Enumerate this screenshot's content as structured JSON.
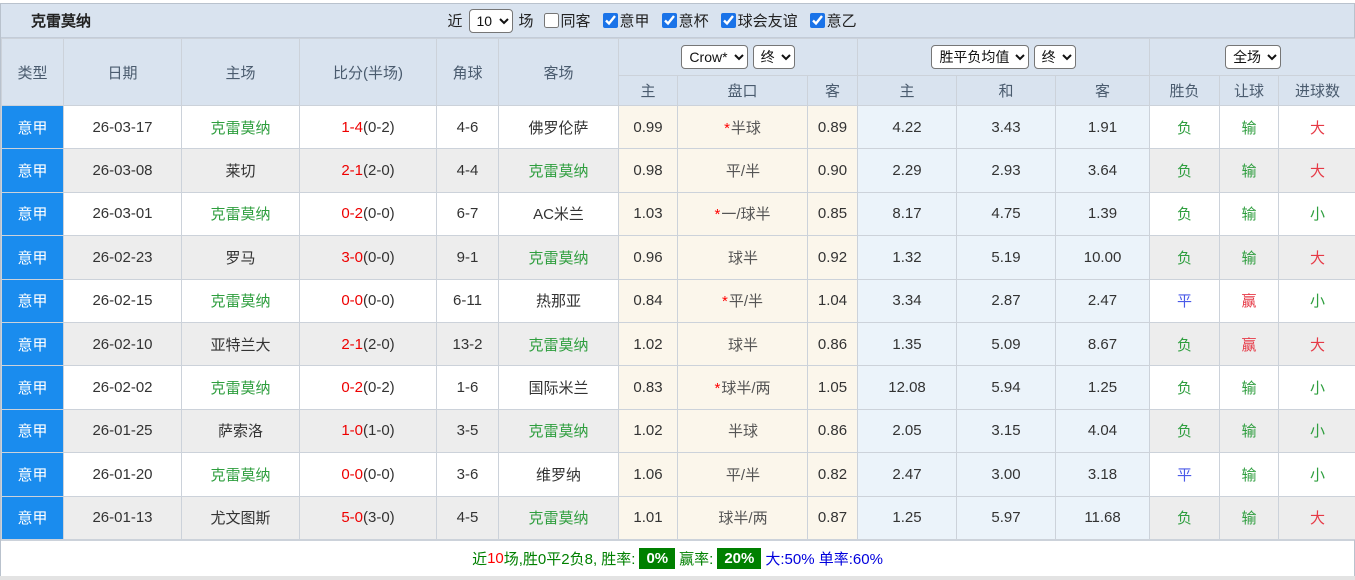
{
  "toolbar": {
    "team": "克雷莫纳",
    "recent_label": "近",
    "recent_value": "10",
    "recent_suffix": "场",
    "filters": [
      {
        "label": "同客",
        "checked": false
      },
      {
        "label": "意甲",
        "checked": true
      },
      {
        "label": "意杯",
        "checked": true
      },
      {
        "label": "球会友谊",
        "checked": true
      },
      {
        "label": "意乙",
        "checked": true
      }
    ]
  },
  "header": {
    "type": "类型",
    "date": "日期",
    "home": "主场",
    "score": "比分(半场)",
    "corner": "角球",
    "away": "客场",
    "odds_company_select": "Crow*",
    "odds_state_select": "终",
    "avg_select": "胜平负均值",
    "avg_state_select": "终",
    "fulltime_select": "全场",
    "odds_home": "主",
    "odds_pan": "盘口",
    "odds_away": "客",
    "avg_win": "主",
    "avg_draw": "和",
    "avg_lose": "客",
    "res_wdl": "胜负",
    "res_handicap": "让球",
    "res_goals": "进球数"
  },
  "rows": [
    {
      "league": "意甲",
      "date": "26-03-17",
      "home": "克雷莫纳",
      "home_c": "green",
      "score": "1-4",
      "half": "(0-2)",
      "corners": "4-6",
      "away": "佛罗伦萨",
      "away_c": "dark",
      "o_home": "0.99",
      "pan_star": "*",
      "pan": "半球",
      "o_away": "0.89",
      "m_win": "4.22",
      "m_draw": "3.43",
      "m_lose": "1.91",
      "r_wdl": "负",
      "r_wdl_c": "green",
      "r_pan": "输",
      "r_pan_c": "green",
      "r_goal": "大",
      "r_goal_c": "red"
    },
    {
      "league": "意甲",
      "date": "26-03-08",
      "home": "莱切",
      "home_c": "dark",
      "score": "2-1",
      "half": "(2-0)",
      "corners": "4-4",
      "away": "克雷莫纳",
      "away_c": "green",
      "o_home": "0.98",
      "pan_star": "",
      "pan": "平/半",
      "o_away": "0.90",
      "m_win": "2.29",
      "m_draw": "2.93",
      "m_lose": "3.64",
      "r_wdl": "负",
      "r_wdl_c": "green",
      "r_pan": "输",
      "r_pan_c": "green",
      "r_goal": "大",
      "r_goal_c": "red"
    },
    {
      "league": "意甲",
      "date": "26-03-01",
      "home": "克雷莫纳",
      "home_c": "green",
      "score": "0-2",
      "half": "(0-0)",
      "corners": "6-7",
      "away": "AC米兰",
      "away_c": "dark",
      "o_home": "1.03",
      "pan_star": "*",
      "pan": "一/球半",
      "o_away": "0.85",
      "m_win": "8.17",
      "m_draw": "4.75",
      "m_lose": "1.39",
      "r_wdl": "负",
      "r_wdl_c": "green",
      "r_pan": "输",
      "r_pan_c": "green",
      "r_goal": "小",
      "r_goal_c": "green"
    },
    {
      "league": "意甲",
      "date": "26-02-23",
      "home": "罗马",
      "home_c": "dark",
      "score": "3-0",
      "half": "(0-0)",
      "corners": "9-1",
      "away": "克雷莫纳",
      "away_c": "green",
      "o_home": "0.96",
      "pan_star": "",
      "pan": "球半",
      "o_away": "0.92",
      "m_win": "1.32",
      "m_draw": "5.19",
      "m_lose": "10.00",
      "r_wdl": "负",
      "r_wdl_c": "green",
      "r_pan": "输",
      "r_pan_c": "green",
      "r_goal": "大",
      "r_goal_c": "red"
    },
    {
      "league": "意甲",
      "date": "26-02-15",
      "home": "克雷莫纳",
      "home_c": "green",
      "score": "0-0",
      "half": "(0-0)",
      "corners": "6-11",
      "away": "热那亚",
      "away_c": "dark",
      "o_home": "0.84",
      "pan_star": "*",
      "pan": "平/半",
      "o_away": "1.04",
      "m_win": "3.34",
      "m_draw": "2.87",
      "m_lose": "2.47",
      "r_wdl": "平",
      "r_wdl_c": "blue",
      "r_pan": "赢",
      "r_pan_c": "red",
      "r_goal": "小",
      "r_goal_c": "green"
    },
    {
      "league": "意甲",
      "date": "26-02-10",
      "home": "亚特兰大",
      "home_c": "dark",
      "score": "2-1",
      "half": "(2-0)",
      "corners": "13-2",
      "away": "克雷莫纳",
      "away_c": "green",
      "o_home": "1.02",
      "pan_star": "",
      "pan": "球半",
      "o_away": "0.86",
      "m_win": "1.35",
      "m_draw": "5.09",
      "m_lose": "8.67",
      "r_wdl": "负",
      "r_wdl_c": "green",
      "r_pan": "赢",
      "r_pan_c": "red",
      "r_goal": "大",
      "r_goal_c": "red"
    },
    {
      "league": "意甲",
      "date": "26-02-02",
      "home": "克雷莫纳",
      "home_c": "green",
      "score": "0-2",
      "half": "(0-2)",
      "corners": "1-6",
      "away": "国际米兰",
      "away_c": "dark",
      "o_home": "0.83",
      "pan_star": "*",
      "pan": "球半/两",
      "o_away": "1.05",
      "m_win": "12.08",
      "m_draw": "5.94",
      "m_lose": "1.25",
      "r_wdl": "负",
      "r_wdl_c": "green",
      "r_pan": "输",
      "r_pan_c": "green",
      "r_goal": "小",
      "r_goal_c": "green"
    },
    {
      "league": "意甲",
      "date": "26-01-25",
      "home": "萨索洛",
      "home_c": "dark",
      "score": "1-0",
      "half": "(1-0)",
      "corners": "3-5",
      "away": "克雷莫纳",
      "away_c": "green",
      "o_home": "1.02",
      "pan_star": "",
      "pan": "半球",
      "o_away": "0.86",
      "m_win": "2.05",
      "m_draw": "3.15",
      "m_lose": "4.04",
      "r_wdl": "负",
      "r_wdl_c": "green",
      "r_pan": "输",
      "r_pan_c": "green",
      "r_goal": "小",
      "r_goal_c": "green"
    },
    {
      "league": "意甲",
      "date": "26-01-20",
      "home": "克雷莫纳",
      "home_c": "green",
      "score": "0-0",
      "half": "(0-0)",
      "corners": "3-6",
      "away": "维罗纳",
      "away_c": "dark",
      "o_home": "1.06",
      "pan_star": "",
      "pan": "平/半",
      "o_away": "0.82",
      "m_win": "2.47",
      "m_draw": "3.00",
      "m_lose": "3.18",
      "r_wdl": "平",
      "r_wdl_c": "blue",
      "r_pan": "输",
      "r_pan_c": "green",
      "r_goal": "小",
      "r_goal_c": "green"
    },
    {
      "league": "意甲",
      "date": "26-01-13",
      "home": "尤文图斯",
      "home_c": "dark",
      "score": "5-0",
      "half": "(3-0)",
      "corners": "4-5",
      "away": "克雷莫纳",
      "away_c": "green",
      "o_home": "1.01",
      "pan_star": "",
      "pan": "球半/两",
      "o_away": "0.87",
      "m_win": "1.25",
      "m_draw": "5.97",
      "m_lose": "11.68",
      "r_wdl": "负",
      "r_wdl_c": "green",
      "r_pan": "输",
      "r_pan_c": "green",
      "r_goal": "大",
      "r_goal_c": "red"
    }
  ],
  "footer": {
    "seg_recent": "近",
    "seg_count": "10",
    "seg_record": "场,胜0平2负8, 胜率:",
    "win_rate": "0%",
    "seg_handicap": "赢率:",
    "handicap_rate": "20%",
    "seg_big": "大:50%",
    "seg_odd": "单率:60%"
  }
}
